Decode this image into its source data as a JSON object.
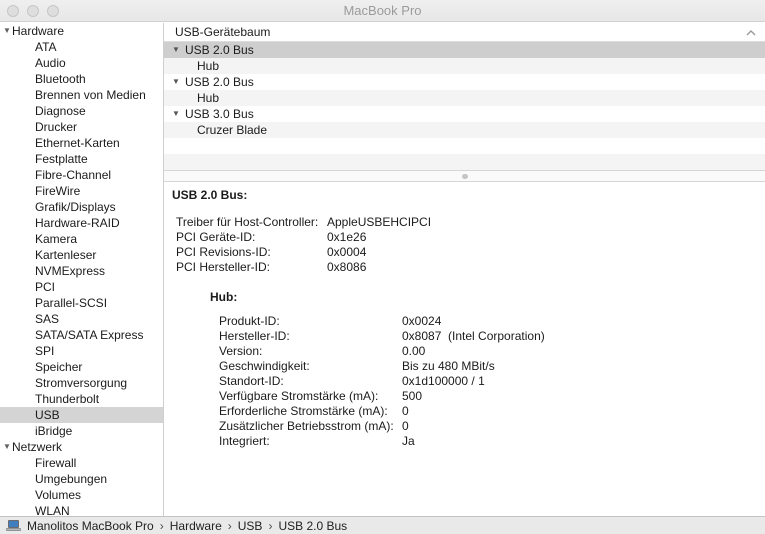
{
  "window": {
    "title": "MacBook Pro"
  },
  "titlebar": {
    "buttons": [
      "close",
      "minimize",
      "zoom"
    ]
  },
  "colors": {
    "selection": "#cecece",
    "sidebar_selection": "#d4d4d4",
    "row_stripe": "#f4f4f5",
    "titlebar_bg": "#ececec",
    "statusbar_bg": "#e9e9e9",
    "laptop_screen_blue": "#3f7fbf"
  },
  "sidebar": {
    "items": [
      {
        "label": "Hardware",
        "type": "section"
      },
      {
        "label": "ATA",
        "type": "item"
      },
      {
        "label": "Audio",
        "type": "item"
      },
      {
        "label": "Bluetooth",
        "type": "item"
      },
      {
        "label": "Brennen von Medien",
        "type": "item"
      },
      {
        "label": "Diagnose",
        "type": "item"
      },
      {
        "label": "Drucker",
        "type": "item"
      },
      {
        "label": "Ethernet-Karten",
        "type": "item"
      },
      {
        "label": "Festplatte",
        "type": "item"
      },
      {
        "label": "Fibre-Channel",
        "type": "item"
      },
      {
        "label": "FireWire",
        "type": "item"
      },
      {
        "label": "Grafik/Displays",
        "type": "item"
      },
      {
        "label": "Hardware-RAID",
        "type": "item"
      },
      {
        "label": "Kamera",
        "type": "item"
      },
      {
        "label": "Kartenleser",
        "type": "item"
      },
      {
        "label": "NVMExpress",
        "type": "item"
      },
      {
        "label": "PCI",
        "type": "item"
      },
      {
        "label": "Parallel-SCSI",
        "type": "item"
      },
      {
        "label": "SAS",
        "type": "item"
      },
      {
        "label": "SATA/SATA Express",
        "type": "item"
      },
      {
        "label": "SPI",
        "type": "item"
      },
      {
        "label": "Speicher",
        "type": "item"
      },
      {
        "label": "Stromversorgung",
        "type": "item"
      },
      {
        "label": "Thunderbolt",
        "type": "item"
      },
      {
        "label": "USB",
        "type": "item",
        "selected": true
      },
      {
        "label": "iBridge",
        "type": "item"
      },
      {
        "label": "Netzwerk",
        "type": "section"
      },
      {
        "label": "Firewall",
        "type": "item"
      },
      {
        "label": "Umgebungen",
        "type": "item"
      },
      {
        "label": "Volumes",
        "type": "item"
      },
      {
        "label": "WLAN",
        "type": "item"
      }
    ]
  },
  "device_tree": {
    "header": "USB-Gerätebaum",
    "collapse_icon": "chevron-up-icon",
    "rows": [
      {
        "label": "USB 2.0 Bus",
        "level": 0,
        "expanded": true,
        "selected": true
      },
      {
        "label": "Hub",
        "level": 1
      },
      {
        "label": "USB 2.0 Bus",
        "level": 0,
        "expanded": true
      },
      {
        "label": "Hub",
        "level": 1
      },
      {
        "label": "USB 3.0 Bus",
        "level": 0,
        "expanded": true
      },
      {
        "label": "Cruzer Blade",
        "level": 1
      }
    ]
  },
  "details": {
    "title": "USB 2.0 Bus:",
    "rows": [
      {
        "label": "Treiber für Host-Controller:",
        "value": "AppleUSBEHCIPCI"
      },
      {
        "label": "PCI Geräte-ID:",
        "value": "0x1e26"
      },
      {
        "label": "PCI Revisions-ID:",
        "value": "0x0004"
      },
      {
        "label": "PCI Hersteller-ID:",
        "value": "0x8086"
      }
    ],
    "subsection": {
      "title": "Hub:",
      "rows": [
        {
          "label": "Produkt-ID:",
          "value": "0x0024"
        },
        {
          "label": "Hersteller-ID:",
          "value": "0x8087  (Intel Corporation)"
        },
        {
          "label": "Version:",
          "value": "0.00"
        },
        {
          "label": "Geschwindigkeit:",
          "value": "Bis zu 480 MBit/s"
        },
        {
          "label": "Standort-ID:",
          "value": "0x1d100000 / 1"
        },
        {
          "label": "Verfügbare Stromstärke (mA):",
          "value": "500"
        },
        {
          "label": "Erforderliche Stromstärke (mA):",
          "value": "0"
        },
        {
          "label": "Zusätzlicher Betriebsstrom (mA):",
          "value": "0"
        },
        {
          "label": "Integriert:",
          "value": "Ja"
        }
      ]
    }
  },
  "statusbar": {
    "computer_icon": "laptop-icon",
    "separator": "›",
    "path": [
      "Manolitos MacBook Pro",
      "Hardware",
      "USB",
      "USB 2.0 Bus"
    ]
  }
}
